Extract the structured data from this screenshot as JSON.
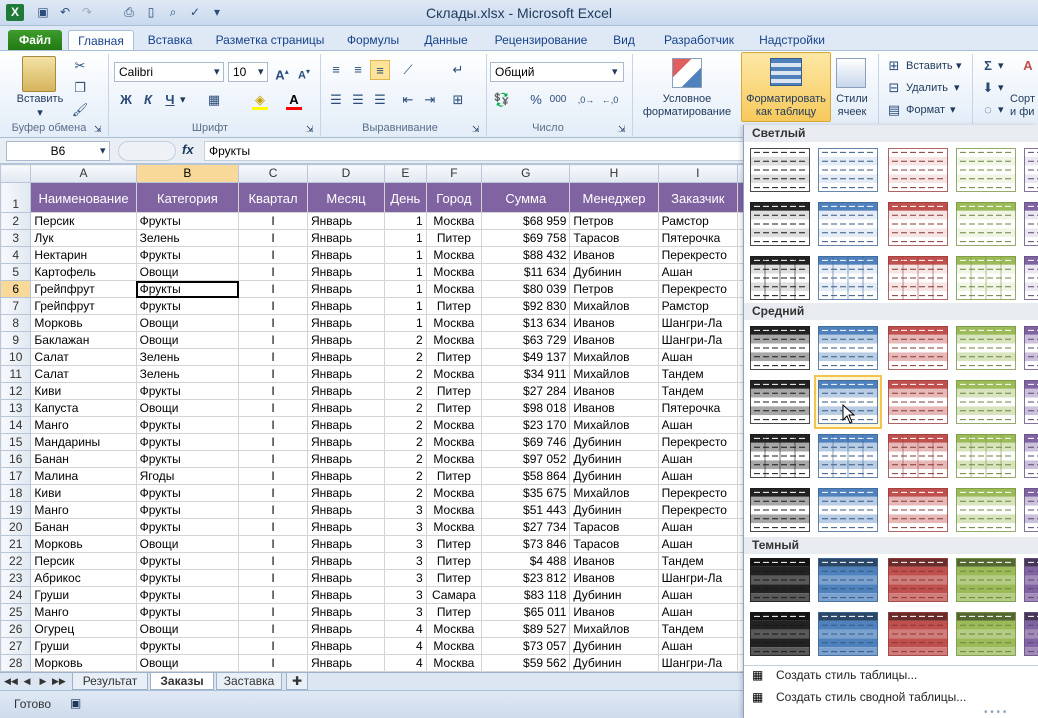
{
  "window": {
    "title": "Склады.xlsx - Microsoft Excel"
  },
  "tabs": [
    "Файл",
    "Главная",
    "Вставка",
    "Разметка страницы",
    "Формулы",
    "Данные",
    "Рецензирование",
    "Вид",
    "Разработчик",
    "Надстройки"
  ],
  "ribbon": {
    "clipboard": {
      "label": "Буфер обмена",
      "paste": "Вставить"
    },
    "font": {
      "label": "Шрифт",
      "name": "Calibri",
      "size": "10",
      "bold": "Ж",
      "italic": "К",
      "underline": "Ч"
    },
    "alignment": {
      "label": "Выравнивание"
    },
    "number": {
      "label": "Число",
      "format": "Общий"
    },
    "styles": {
      "conditional_1": "Условное",
      "conditional_2": "форматирование",
      "format_table_1": "Форматировать",
      "format_table_2": "как таблицу",
      "cell_styles_1": "Стили",
      "cell_styles_2": "ячеек"
    },
    "cells": {
      "insert": "Вставить",
      "delete": "Удалить",
      "format": "Формат"
    },
    "editing": {
      "sort_1": "Сорт",
      "sort_2": "и фи"
    }
  },
  "formula_bar": {
    "name_box": "B6",
    "fx": "fx",
    "value": "Фрукты"
  },
  "columns": [
    "A",
    "B",
    "C",
    "D",
    "E",
    "F",
    "G",
    "H",
    "I"
  ],
  "headers": [
    "Наименование",
    "Категория",
    "Квартал",
    "Месяц",
    "День",
    "Город",
    "Сумма",
    "Менеджер",
    "Заказчик"
  ],
  "rows": [
    [
      "Персик",
      "Фрукты",
      "I",
      "Январь",
      "1",
      "Москва",
      "$68 959",
      "Петров",
      "Рамстор"
    ],
    [
      "Лук",
      "Зелень",
      "I",
      "Январь",
      "1",
      "Питер",
      "$69 758",
      "Тарасов",
      "Пятерочка"
    ],
    [
      "Нектарин",
      "Фрукты",
      "I",
      "Январь",
      "1",
      "Москва",
      "$88 432",
      "Иванов",
      "Перекресто"
    ],
    [
      "Картофель",
      "Овощи",
      "I",
      "Январь",
      "1",
      "Москва",
      "$11 634",
      "Дубинин",
      "Ашан"
    ],
    [
      "Грейпфрут",
      "Фрукты",
      "I",
      "Январь",
      "1",
      "Москва",
      "$80 039",
      "Петров",
      "Перекресто"
    ],
    [
      "Грейпфрут",
      "Фрукты",
      "I",
      "Январь",
      "1",
      "Питер",
      "$92 830",
      "Михайлов",
      "Рамстор"
    ],
    [
      "Морковь",
      "Овощи",
      "I",
      "Январь",
      "1",
      "Москва",
      "$13 634",
      "Иванов",
      "Шангри-Ла"
    ],
    [
      "Баклажан",
      "Овощи",
      "I",
      "Январь",
      "2",
      "Москва",
      "$63 729",
      "Иванов",
      "Шангри-Ла"
    ],
    [
      "Салат",
      "Зелень",
      "I",
      "Январь",
      "2",
      "Питер",
      "$49 137",
      "Михайлов",
      "Ашан"
    ],
    [
      "Салат",
      "Зелень",
      "I",
      "Январь",
      "2",
      "Москва",
      "$34 911",
      "Михайлов",
      "Тандем"
    ],
    [
      "Киви",
      "Фрукты",
      "I",
      "Январь",
      "2",
      "Питер",
      "$27 284",
      "Иванов",
      "Тандем"
    ],
    [
      "Капуста",
      "Овощи",
      "I",
      "Январь",
      "2",
      "Питер",
      "$98 018",
      "Иванов",
      "Пятерочка"
    ],
    [
      "Манго",
      "Фрукты",
      "I",
      "Январь",
      "2",
      "Москва",
      "$23 170",
      "Михайлов",
      "Ашан"
    ],
    [
      "Мандарины",
      "Фрукты",
      "I",
      "Январь",
      "2",
      "Москва",
      "$69 746",
      "Дубинин",
      "Перекресто"
    ],
    [
      "Банан",
      "Фрукты",
      "I",
      "Январь",
      "2",
      "Москва",
      "$97 052",
      "Дубинин",
      "Ашан"
    ],
    [
      "Малина",
      "Ягоды",
      "I",
      "Январь",
      "2",
      "Питер",
      "$58 864",
      "Дубинин",
      "Ашан"
    ],
    [
      "Киви",
      "Фрукты",
      "I",
      "Январь",
      "2",
      "Москва",
      "$35 675",
      "Михайлов",
      "Перекресто"
    ],
    [
      "Манго",
      "Фрукты",
      "I",
      "Январь",
      "3",
      "Москва",
      "$51 443",
      "Дубинин",
      "Перекресто"
    ],
    [
      "Банан",
      "Фрукты",
      "I",
      "Январь",
      "3",
      "Москва",
      "$27 734",
      "Тарасов",
      "Ашан"
    ],
    [
      "Морковь",
      "Овощи",
      "I",
      "Январь",
      "3",
      "Питер",
      "$73 846",
      "Тарасов",
      "Ашан"
    ],
    [
      "Персик",
      "Фрукты",
      "I",
      "Январь",
      "3",
      "Питер",
      "$4 488",
      "Иванов",
      "Тандем"
    ],
    [
      "Абрикос",
      "Фрукты",
      "I",
      "Январь",
      "3",
      "Питер",
      "$23 812",
      "Иванов",
      "Шангри-Ла"
    ],
    [
      "Груши",
      "Фрукты",
      "I",
      "Январь",
      "3",
      "Самара",
      "$83 118",
      "Дубинин",
      "Ашан"
    ],
    [
      "Манго",
      "Фрукты",
      "I",
      "Январь",
      "3",
      "Питер",
      "$65 011",
      "Иванов",
      "Ашан"
    ],
    [
      "Огурец",
      "Овощи",
      "I",
      "Январь",
      "4",
      "Москва",
      "$89 527",
      "Михайлов",
      "Тандем"
    ],
    [
      "Груши",
      "Фрукты",
      "I",
      "Январь",
      "4",
      "Москва",
      "$73 057",
      "Дубинин",
      "Ашан"
    ],
    [
      "Морковь",
      "Овощи",
      "I",
      "Январь",
      "4",
      "Москва",
      "$59 562",
      "Дубинин",
      "Шангри-Ла"
    ]
  ],
  "selected_cell": "B6",
  "sheets": [
    "Результат",
    "Заказы",
    "Заставка"
  ],
  "active_sheet": "Заказы",
  "status": {
    "ready": "Готово"
  },
  "gallery": {
    "sections": [
      "Светлый",
      "Средний",
      "Темный"
    ],
    "actions": [
      "Создать стиль таблицы...",
      "Создать стиль сводной таблицы..."
    ],
    "colors": [
      "#222222",
      "#4f81bd",
      "#c0504d",
      "#9bbb59",
      "#8064a2"
    ]
  }
}
